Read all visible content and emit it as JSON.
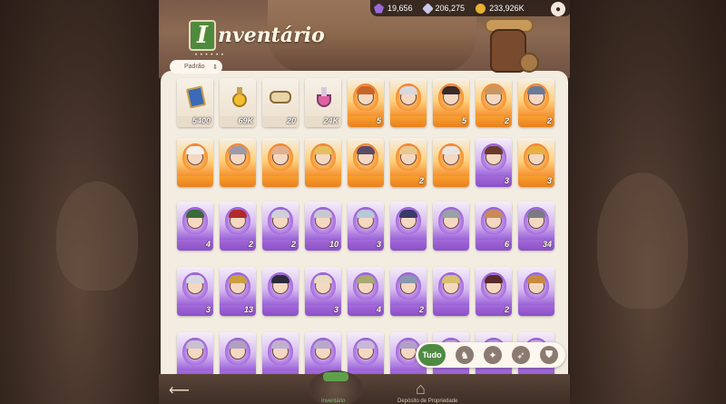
{
  "currencies": [
    {
      "icon": "purple-gem-icon",
      "value": "19,656"
    },
    {
      "icon": "diamond-icon",
      "value": "206,275"
    },
    {
      "icon": "gold-coin-icon",
      "value": "233,926K"
    }
  ],
  "title": {
    "badge_letter": "I",
    "rest": "nventário"
  },
  "sort": {
    "selected": "Padrão"
  },
  "items": [
    {
      "kind": "item",
      "shape": "book",
      "count": "5400"
    },
    {
      "kind": "item",
      "shape": "potion",
      "count": "69K"
    },
    {
      "kind": "item",
      "shape": "scroll",
      "count": "20"
    },
    {
      "kind": "item",
      "shape": "flask",
      "count": "24K"
    },
    {
      "kind": "fire",
      "hair": "#c8642a",
      "count": "5"
    },
    {
      "kind": "fire",
      "hair": "#d8d8e0",
      "count": ""
    },
    {
      "kind": "fire",
      "hair": "#3a2a2a",
      "count": "5"
    },
    {
      "kind": "fire",
      "hair": "#c89860",
      "count": "2"
    },
    {
      "kind": "fire",
      "hair": "#6a7a9a",
      "count": "2"
    },
    {
      "kind": "fire",
      "hair": "#f4f0ee",
      "count": ""
    },
    {
      "kind": "fire",
      "hair": "#9a9aa8",
      "count": ""
    },
    {
      "kind": "fire",
      "hair": "#e0b090",
      "count": ""
    },
    {
      "kind": "fire",
      "hair": "#e6c060",
      "count": ""
    },
    {
      "kind": "fire",
      "hair": "#5a4a6a",
      "count": ""
    },
    {
      "kind": "fire",
      "hair": "#e8c890",
      "count": "2"
    },
    {
      "kind": "fire",
      "hair": "#e8e4e4",
      "count": ""
    },
    {
      "kind": "purp",
      "hair": "#6a3a2a",
      "count": "3"
    },
    {
      "kind": "fire",
      "hair": "#e8b040",
      "count": "3"
    },
    {
      "kind": "purp",
      "hair": "#3a6a3a",
      "count": "4"
    },
    {
      "kind": "purp",
      "hair": "#b02a2a",
      "count": "2"
    },
    {
      "kind": "purp",
      "hair": "#d0d0d8",
      "count": "2"
    },
    {
      "kind": "purp",
      "hair": "#c8c8d0",
      "count": "10"
    },
    {
      "kind": "purp",
      "hair": "#b8c8d8",
      "count": "3"
    },
    {
      "kind": "purp",
      "hair": "#3a3a6a",
      "count": ""
    },
    {
      "kind": "purp",
      "hair": "#9aa0a8",
      "count": ""
    },
    {
      "kind": "purp",
      "hair": "#c88a5a",
      "count": "6"
    },
    {
      "kind": "purp",
      "hair": "#7a7a82",
      "count": "34"
    },
    {
      "kind": "purp",
      "hair": "#d8d8e0",
      "count": "3"
    },
    {
      "kind": "purp",
      "hair": "#c8a040",
      "count": "13"
    },
    {
      "kind": "purp",
      "hair": "#2a2a3a",
      "count": ""
    },
    {
      "kind": "purp",
      "hair": "#e8dcc0",
      "count": "3"
    },
    {
      "kind": "purp",
      "hair": "#a8a870",
      "count": "4"
    },
    {
      "kind": "purp",
      "hair": "#8898b0",
      "count": "2"
    },
    {
      "kind": "purp",
      "hair": "#d8c070",
      "count": ""
    },
    {
      "kind": "purp",
      "hair": "#5a2a2a",
      "count": "2"
    },
    {
      "kind": "purp",
      "hair": "#c88a40",
      "count": ""
    },
    {
      "kind": "purp",
      "hair": "#c8c0d0",
      "count": ""
    },
    {
      "kind": "purp",
      "hair": "#b0a0c0",
      "count": ""
    },
    {
      "kind": "purp",
      "hair": "#c0b0d0",
      "count": ""
    },
    {
      "kind": "purp",
      "hair": "#b8a8c8",
      "count": ""
    },
    {
      "kind": "purp",
      "hair": "#c8b8d8",
      "count": ""
    },
    {
      "kind": "purp",
      "hair": "#b0a0c8",
      "count": ""
    },
    {
      "kind": "purp",
      "hair": "#c0b0c8",
      "count": ""
    },
    {
      "kind": "purp",
      "hair": "#b8a8d0",
      "count": ""
    },
    {
      "kind": "purp",
      "hair": "#c8b8d0",
      "count": ""
    }
  ],
  "filters": {
    "all_label": "Tudo",
    "icons": [
      "warrior-class-icon",
      "mage-class-icon",
      "ranger-class-icon",
      "tank-class-icon"
    ],
    "glyphs": [
      "♞",
      "✦",
      "➶",
      "⛊"
    ]
  },
  "nav": {
    "back_glyph": "⟵",
    "active_label": "Inventário",
    "other_label": "Depósito de Propriedade"
  }
}
